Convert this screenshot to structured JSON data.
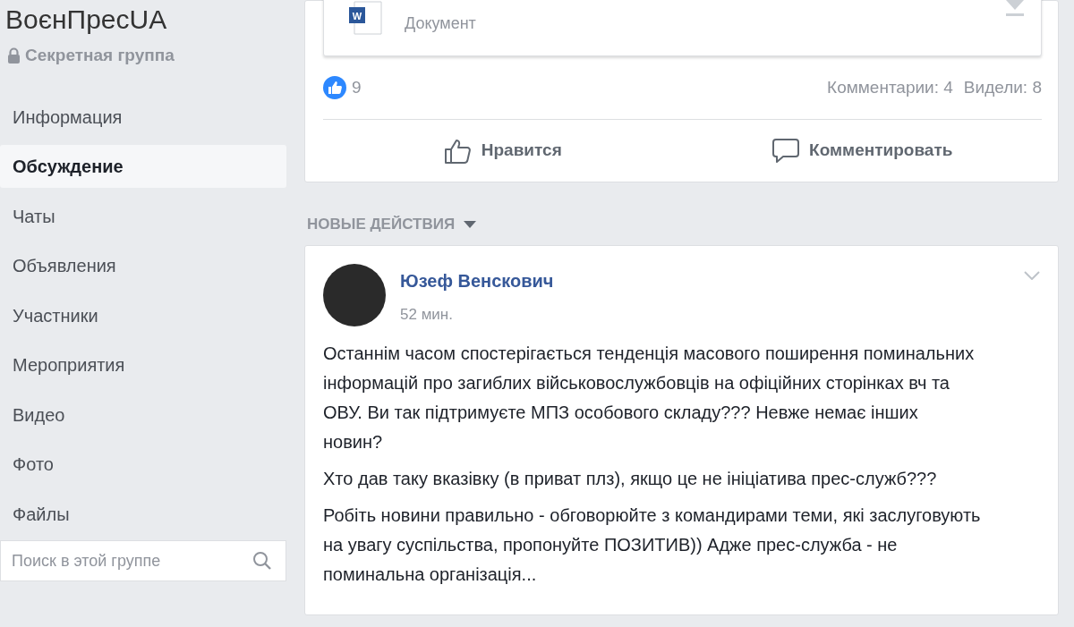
{
  "group": {
    "name": "ВоєнПресUA",
    "privacy": "Секретная группа"
  },
  "sidebar": {
    "items": [
      {
        "label": "Информация",
        "selected": false
      },
      {
        "label": "Обсуждение",
        "selected": true
      },
      {
        "label": "Чаты",
        "selected": false
      },
      {
        "label": "Объявления",
        "selected": false
      },
      {
        "label": "Участники",
        "selected": false
      },
      {
        "label": "Мероприятия",
        "selected": false
      },
      {
        "label": "Видео",
        "selected": false
      },
      {
        "label": "Фото",
        "selected": false
      },
      {
        "label": "Файлы",
        "selected": false
      }
    ],
    "search": {
      "placeholder": "Поиск в этой группе"
    }
  },
  "previous_post": {
    "attachment": {
      "icon_letter": "W",
      "type": "Документ"
    },
    "likes": "9",
    "comments": "Комментарии: 4",
    "views": "Видели: 8",
    "actions": [
      "Нравится",
      "Комментировать"
    ]
  },
  "section_header": "НОВЫЕ ДЕЙСТВИЯ",
  "post": {
    "author": "Юзеф Венскович",
    "time": "52 мин.",
    "paragraphs": [
      "Останнім часом спостерігається тенденція масового поширення поминальних інформацій про загиблих військовослужбовців на офіційних сторінках вч та ОВУ. Ви так підтримуєте МПЗ особового складу??? Невже немає інших новин?",
      "Хто дав таку вказівку (в приват плз), якщо це не ініціатива прес-служб???",
      "Робіть новини правильно - обговорюйте з командирами теми, які заслуговують на увагу суспільства, пропонуйте ПОЗИТИВ)) Адже прес-служба - не поминальна організація..."
    ]
  }
}
